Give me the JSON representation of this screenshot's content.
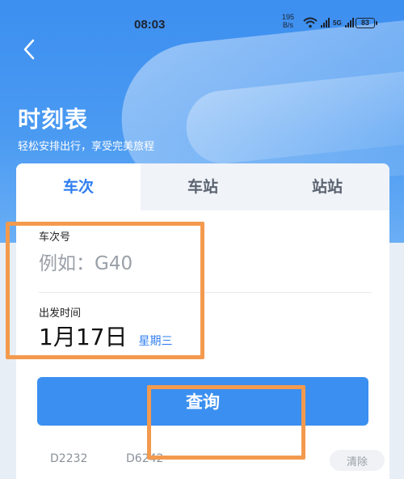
{
  "status_bar": {
    "time": "08:03",
    "net_speed_value": "195",
    "net_speed_unit": "B/s",
    "network_type": "5G",
    "battery": "83"
  },
  "header": {
    "title": "时刻表",
    "subtitle": "轻松安排出行，享受完美旅程"
  },
  "tabs": [
    {
      "label": "车次",
      "active": true
    },
    {
      "label": "车站",
      "active": false
    },
    {
      "label": "站站",
      "active": false
    }
  ],
  "form": {
    "train_no_label": "车次号",
    "train_no_placeholder": "例如：G40",
    "date_label": "出发时间",
    "date_value": "1月17日",
    "weekday": "星期三",
    "query_label": "查询"
  },
  "history": {
    "items": [
      "D2232",
      "D6242"
    ],
    "clear_label": "清除"
  },
  "colors": {
    "accent": "#2f7ef0",
    "button": "#3b8ff0",
    "highlight": "#f39a4e"
  }
}
